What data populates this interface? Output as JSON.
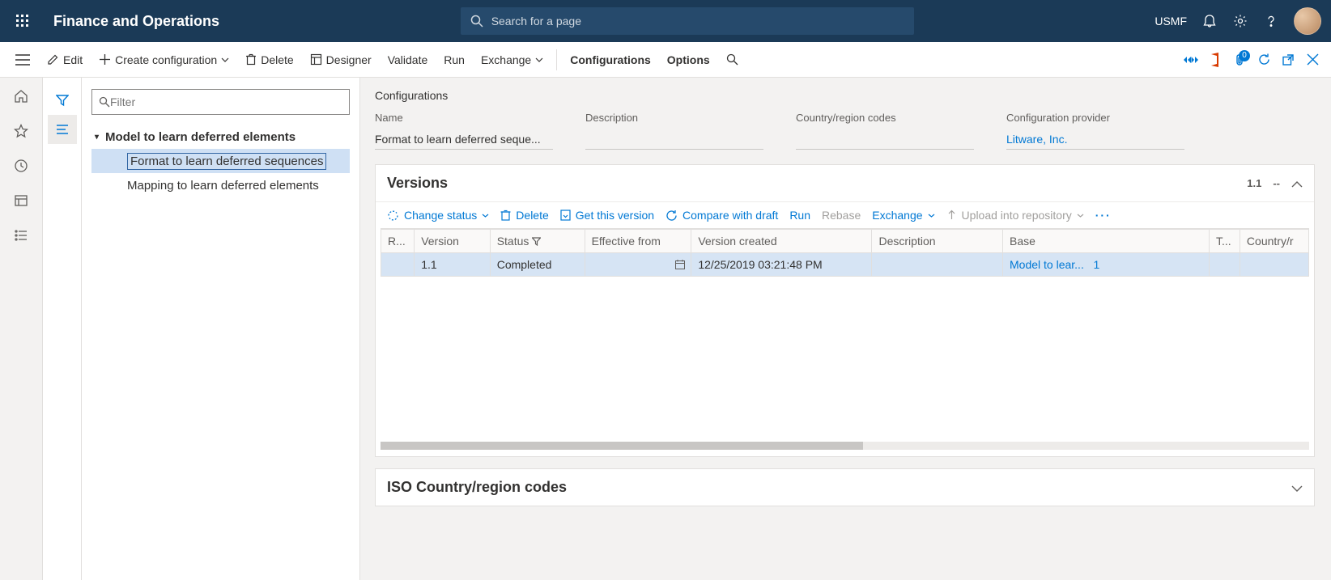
{
  "header": {
    "brand": "Finance and Operations",
    "search_placeholder": "Search for a page",
    "company": "USMF"
  },
  "commands": {
    "edit": "Edit",
    "create": "Create configuration",
    "delete": "Delete",
    "designer": "Designer",
    "validate": "Validate",
    "run": "Run",
    "exchange": "Exchange",
    "configurations": "Configurations",
    "options": "Options",
    "attach_badge": "0"
  },
  "tree": {
    "filter_placeholder": "Filter",
    "root": "Model to learn deferred elements",
    "children": [
      "Format to learn deferred sequences",
      "Mapping to learn deferred elements"
    ]
  },
  "config": {
    "page_title": "Configurations",
    "labels": {
      "name": "Name",
      "description": "Description",
      "codes": "Country/region codes",
      "provider": "Configuration provider"
    },
    "name": "Format to learn deferred seque...",
    "description": "",
    "codes": "",
    "provider": "Litware, Inc."
  },
  "versions": {
    "title": "Versions",
    "current": "1.1",
    "dash": "--",
    "toolbar": {
      "change_status": "Change status",
      "delete": "Delete",
      "get": "Get this version",
      "compare": "Compare with draft",
      "run": "Run",
      "rebase": "Rebase",
      "exchange": "Exchange",
      "upload": "Upload into repository"
    },
    "columns": {
      "r": "R...",
      "version": "Version",
      "status": "Status",
      "effective": "Effective from",
      "created": "Version created",
      "description": "Description",
      "base": "Base",
      "t": "T...",
      "country": "Country/r"
    },
    "rows": [
      {
        "version": "1.1",
        "status": "Completed",
        "effective": "",
        "created": "12/25/2019 03:21:48 PM",
        "description": "",
        "base": "Model to lear...",
        "base_suffix": "1",
        "t": "",
        "country": ""
      }
    ]
  },
  "iso": {
    "title": "ISO Country/region codes"
  }
}
